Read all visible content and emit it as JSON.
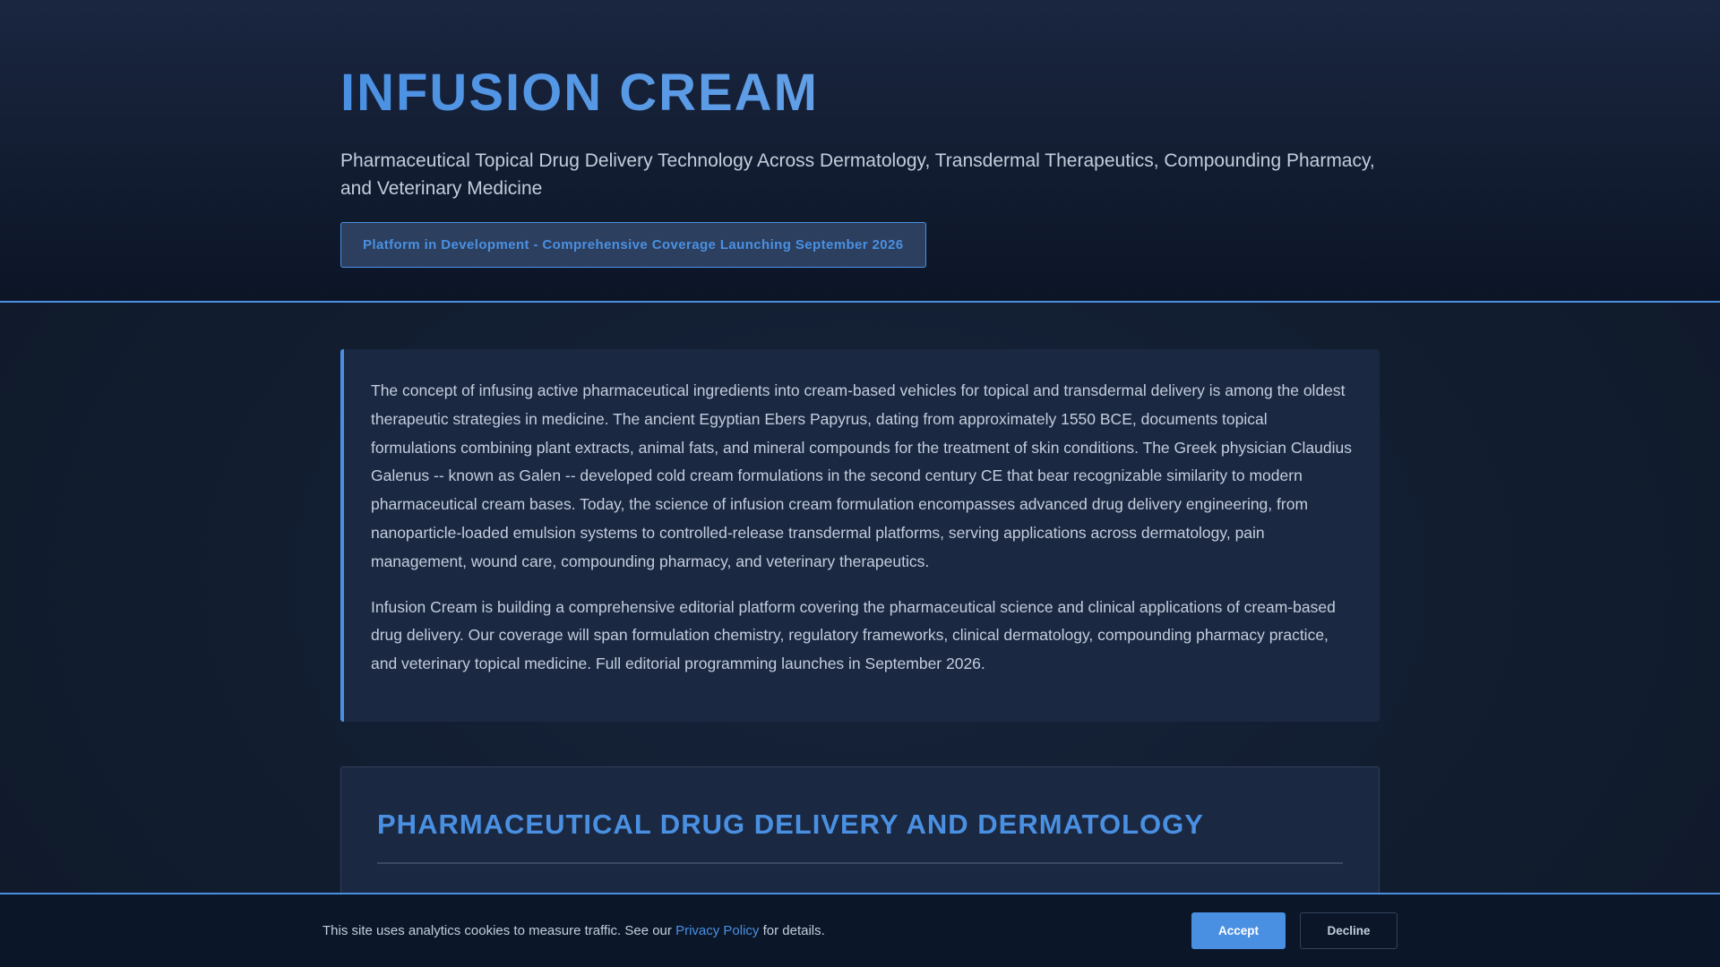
{
  "header": {
    "title": "INFUSION CREAM",
    "subtitle": "Pharmaceutical Topical Drug Delivery Technology Across Dermatology, Transdermal Therapeutics, Compounding Pharmacy, and Veterinary Medicine",
    "badge": "Platform in Development - Comprehensive Coverage Launching September 2026"
  },
  "intro": {
    "paragraphs": [
      "The concept of infusing active pharmaceutical ingredients into cream-based vehicles for topical and transdermal delivery is among the oldest therapeutic strategies in medicine. The ancient Egyptian Ebers Papyrus, dating from approximately 1550 BCE, documents topical formulations combining plant extracts, animal fats, and mineral compounds for the treatment of skin conditions. The Greek physician Claudius Galenus -- known as Galen -- developed cold cream formulations in the second century CE that bear recognizable similarity to modern pharmaceutical cream bases. Today, the science of infusion cream formulation encompasses advanced drug delivery engineering, from nanoparticle-loaded emulsion systems to controlled-release transdermal platforms, serving applications across dermatology, pain management, wound care, compounding pharmacy, and veterinary therapeutics.",
      "Infusion Cream is building a comprehensive editorial platform covering the pharmaceutical science and clinical applications of cream-based drug delivery. Our coverage will span formulation chemistry, regulatory frameworks, clinical dermatology, compounding pharmacy practice, and veterinary topical medicine. Full editorial programming launches in September 2026."
    ]
  },
  "section": {
    "heading": "PHARMACEUTICAL DRUG DELIVERY AND DERMATOLOGY"
  },
  "cookie": {
    "text_before": "This site uses analytics cookies to measure traffic. See our ",
    "link": "Privacy Policy",
    "text_after": " for details.",
    "accept": "Accept",
    "decline": "Decline"
  }
}
